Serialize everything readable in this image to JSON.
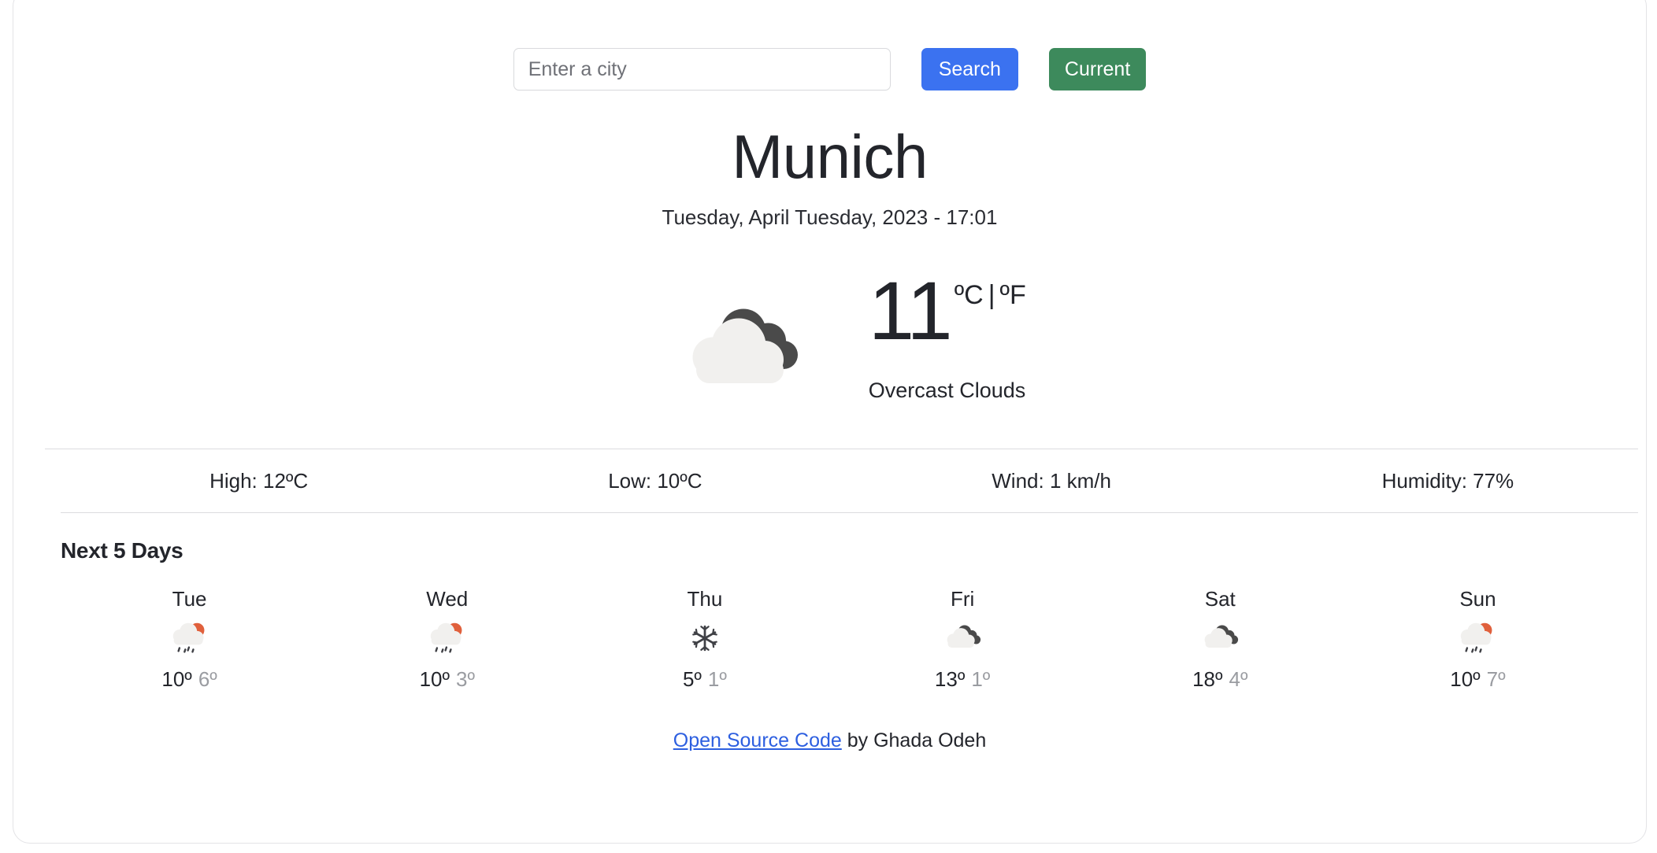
{
  "search": {
    "placeholder": "Enter a city",
    "value": "",
    "search_label": "Search",
    "current_label": "Current"
  },
  "current": {
    "city": "Munich",
    "date": "Tuesday, April Tuesday, 2023 - 17:01",
    "temperature": "11",
    "unit_celsius": "ºC",
    "unit_separator": "|",
    "unit_fahrenheit": "ºF",
    "condition": "Overcast Clouds",
    "icon": "overcast-clouds-icon"
  },
  "stats": [
    {
      "label": "High: 12ºC"
    },
    {
      "label": "Low: 10ºC"
    },
    {
      "label": "Wind: 1 km/h"
    },
    {
      "label": "Humidity: 77%"
    }
  ],
  "forecast": {
    "title": "Next 5 Days",
    "days": [
      {
        "day": "Tue",
        "icon": "sun-cloud-rain-icon",
        "max": "10º",
        "min": "6º"
      },
      {
        "day": "Wed",
        "icon": "sun-cloud-rain-icon",
        "max": "10º",
        "min": "3º"
      },
      {
        "day": "Thu",
        "icon": "snowflake-icon",
        "max": "5º",
        "min": "1º"
      },
      {
        "day": "Fri",
        "icon": "overcast-clouds-icon",
        "max": "13º",
        "min": "1º"
      },
      {
        "day": "Sat",
        "icon": "overcast-clouds-icon",
        "max": "18º",
        "min": "4º"
      },
      {
        "day": "Sun",
        "icon": "sun-cloud-rain-icon",
        "max": "10º",
        "min": "7º"
      }
    ]
  },
  "footer": {
    "link_text": "Open Source Code",
    "credit_text": " by Ghada Odeh"
  },
  "colors": {
    "search_button": "#3b72f0",
    "current_button": "#3d8a5c",
    "link": "#2d5fe0",
    "cloud_light": "#f1f0ee",
    "cloud_dark": "#4a4a4a",
    "sun": "#e0603c",
    "text": "#23252b",
    "muted_text": "#9a9ca1"
  }
}
